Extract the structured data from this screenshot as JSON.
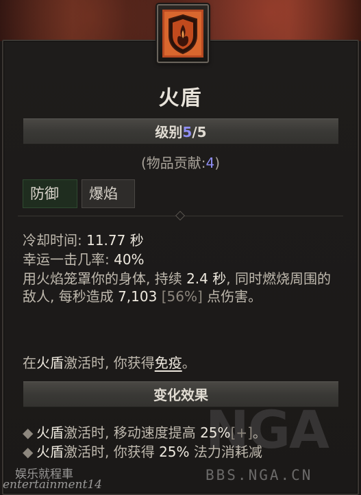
{
  "skill": {
    "name": "火盾",
    "icon": "fire-shield-icon"
  },
  "level": {
    "label": "级别",
    "current": "5",
    "separator": "/",
    "max": "5"
  },
  "contribution": {
    "prefix": "(物品贡献:",
    "value": "4",
    "suffix": ")"
  },
  "tags": [
    {
      "label": "防御"
    },
    {
      "label": "爆焰"
    }
  ],
  "stats": {
    "cooldown_label": "冷却时间: ",
    "cooldown_value": "11.77 秒",
    "lucky_label": "幸运一击几率: ",
    "lucky_value": "40%"
  },
  "description": {
    "part1": "用火焰笼罩你的身体, 持续 ",
    "duration": "2.4 秒",
    "part2": ", 同时燃烧周围的敌人, 每秒造成 ",
    "damage": "7,103",
    "damage_pct": " [56%]",
    "part3": " 点伤害。"
  },
  "immune_line": {
    "prefix": "在",
    "skill": "火盾",
    "middle": "激活时, 你获得",
    "keyword": "免疫",
    "suffix": "。"
  },
  "effects_header": "变化效果",
  "effects": [
    {
      "skill": "火盾",
      "text": "激活时, 移动速度提高 ",
      "value": "25%",
      "extra": "[+]",
      "end": "。"
    },
    {
      "skill": "火盾",
      "text": "激活时, 你获得 ",
      "value": "25%",
      "extra": "",
      "end": " 法力消耗减"
    }
  ],
  "watermarks": {
    "site_logo": "NGA",
    "site_url": "BBS.NGA.CN",
    "author_cn": "娱乐就程車",
    "author_en": "entertainment14"
  },
  "colors": {
    "accent_blue": "#8f8ef2",
    "panel_bg": "#1b1918",
    "defense_tag_bg": "#1f2d1f"
  }
}
